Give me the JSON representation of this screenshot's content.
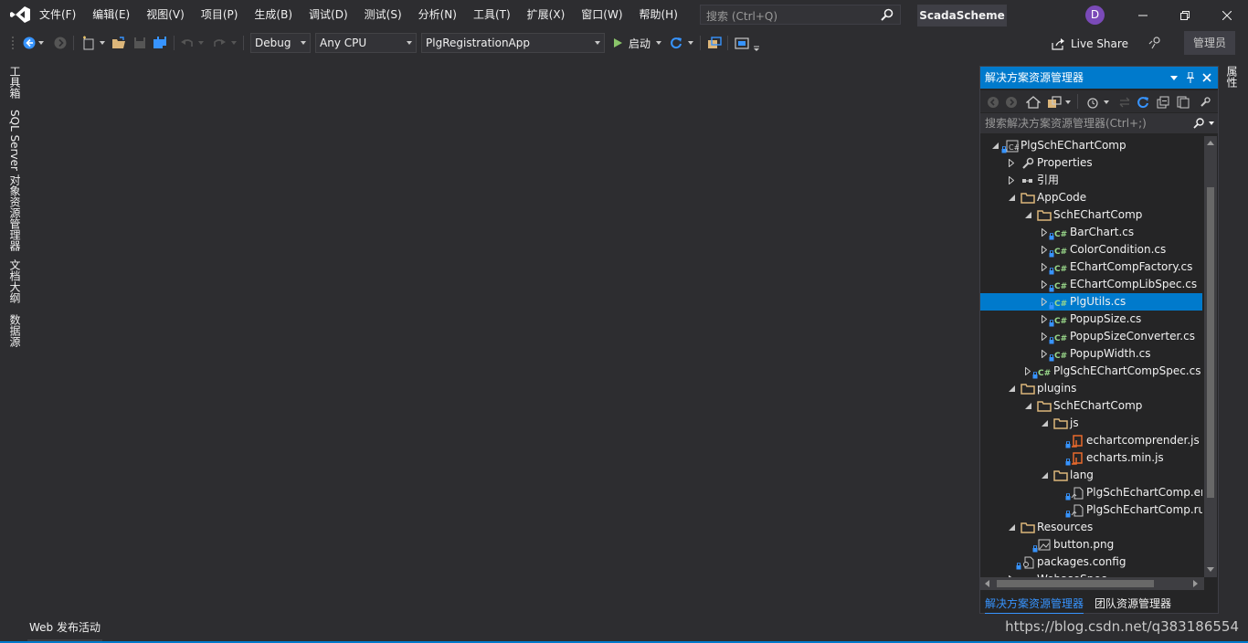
{
  "title_bar": {
    "menu": [
      "文件(F)",
      "编辑(E)",
      "视图(V)",
      "项目(P)",
      "生成(B)",
      "调试(D)",
      "测试(S)",
      "分析(N)",
      "工具(T)",
      "扩展(X)",
      "窗口(W)",
      "帮助(H)"
    ],
    "search_placeholder": "搜索 (Ctrl+Q)",
    "solution_name": "ScadaScheme",
    "avatar_initial": "D"
  },
  "toolbar": {
    "configuration": "Debug",
    "platform": "Any CPU",
    "startup_project": "PlgRegistrationApp",
    "start_label": "启动",
    "live_share": "Live Share",
    "admin": "管理员"
  },
  "left_tabs": [
    "工具箱",
    "SQL Server 对象资源管理器",
    "文档大纲",
    "数据源"
  ],
  "right_tab": "属性",
  "solution_explorer": {
    "title": "解决方案资源管理器",
    "search_placeholder": "搜索解决方案资源管理器(Ctrl+;)",
    "tree": [
      {
        "label": "PlgSchEChartComp",
        "icon": "csharp-project-icon",
        "expanded": true
      },
      {
        "label": "Properties",
        "icon": "wrench-icon",
        "expanded": false
      },
      {
        "label": "引用",
        "icon": "references-icon",
        "expanded": false
      },
      {
        "label": "AppCode",
        "icon": "folder-icon",
        "expanded": true
      },
      {
        "label": "SchEChartComp",
        "icon": "folder-icon",
        "expanded": true
      },
      {
        "label": "BarChart.cs",
        "icon": "csharp-file-icon",
        "expanded": false
      },
      {
        "label": "ColorCondition.cs",
        "icon": "csharp-file-icon",
        "expanded": false
      },
      {
        "label": "EChartCompFactory.cs",
        "icon": "csharp-file-icon",
        "expanded": false
      },
      {
        "label": "EChartCompLibSpec.cs",
        "icon": "csharp-file-icon",
        "expanded": false
      },
      {
        "label": "PlgUtils.cs",
        "icon": "csharp-file-icon",
        "expanded": false,
        "selected": true
      },
      {
        "label": "PopupSize.cs",
        "icon": "csharp-file-icon",
        "expanded": false
      },
      {
        "label": "PopupSizeConverter.cs",
        "icon": "csharp-file-icon",
        "expanded": false
      },
      {
        "label": "PopupWidth.cs",
        "icon": "csharp-file-icon",
        "expanded": false
      },
      {
        "label": "PlgSchEChartCompSpec.cs",
        "icon": "csharp-file-icon",
        "expanded": false
      },
      {
        "label": "plugins",
        "icon": "folder-icon",
        "expanded": true
      },
      {
        "label": "SchEChartComp",
        "icon": "folder-icon",
        "expanded": true
      },
      {
        "label": "js",
        "icon": "folder-icon",
        "expanded": true
      },
      {
        "label": "echartcomprender.js",
        "icon": "js-file-icon"
      },
      {
        "label": "echarts.min.js",
        "icon": "js-file-icon"
      },
      {
        "label": "lang",
        "icon": "folder-icon",
        "expanded": true
      },
      {
        "label": "PlgSchEchartComp.en.js",
        "icon": "text-file-icon"
      },
      {
        "label": "PlgSchEchartComp.ru.js",
        "icon": "text-file-icon"
      },
      {
        "label": "Resources",
        "icon": "folder-icon",
        "expanded": true
      },
      {
        "label": "button.png",
        "icon": "image-file-icon"
      },
      {
        "label": "packages.config",
        "icon": "config-file-icon"
      },
      {
        "label": "WebaseSpec",
        "icon": "csharp-file-icon",
        "expanded": false
      }
    ],
    "tabs": [
      "解决方案资源管理器",
      "团队资源管理器"
    ]
  },
  "status_bar": {
    "web_publish": "Web 发布活动",
    "watermark": "https://blog.csdn.net/q383186554"
  },
  "colors": {
    "accent": "#007acc",
    "background": "#2d2d30",
    "panel": "#252526",
    "csharp_green": "#9ad98b",
    "folder": "#dcb67a",
    "js_orange": "#e8692c"
  }
}
